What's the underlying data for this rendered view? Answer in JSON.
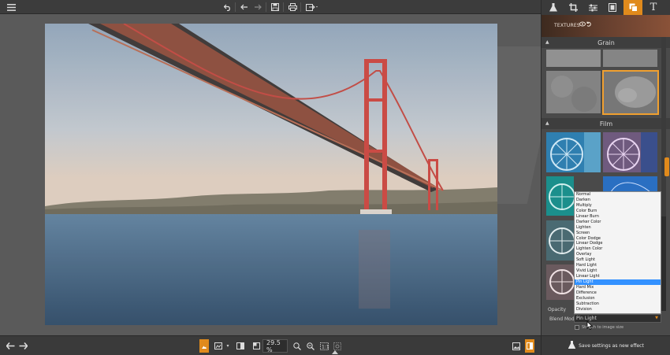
{
  "toolbar": {
    "menu_icon": "hamburger-icon",
    "undo_icon": "undo-icon",
    "undo2_icon": "undo-icon",
    "redo_icon": "redo-icon",
    "save_icon": "save-icon",
    "print_icon": "print-icon",
    "export_icon": "export-icon"
  },
  "panel": {
    "tabs": [
      {
        "name": "flask-icon"
      },
      {
        "name": "crop-icon"
      },
      {
        "name": "sliders-icon"
      },
      {
        "name": "frame-icon"
      },
      {
        "name": "layers-icon",
        "active": true
      },
      {
        "name": "text-icon",
        "label": "T"
      }
    ],
    "textures_title": "TEXTURES",
    "sections": {
      "grain": "Grain",
      "film": "Film"
    },
    "blend_options": [
      "Normal",
      "Darken",
      "Multiply",
      "Color Burn",
      "Linear Burn",
      "Darker Color",
      "Lighten",
      "Screen",
      "Color Dodge",
      "Linear Dodge",
      "Lighten Color",
      "Overlay",
      "Soft Light",
      "Hard Light",
      "Vivid Light",
      "Linear Light",
      "Pin Light",
      "Hard Mix",
      "Difference",
      "Exclusion",
      "Subtraction",
      "Division"
    ],
    "blend_selected": "Pin Light",
    "opacity_label": "Opacity",
    "blend_label": "Blend Mode",
    "stretch_label": "Stretch to image size",
    "save_label": "Save settings as new effect"
  },
  "bottom": {
    "zoom": "29.5 %"
  },
  "colors": {
    "accent": "#e08a1c",
    "highlight": "#3391ff"
  }
}
